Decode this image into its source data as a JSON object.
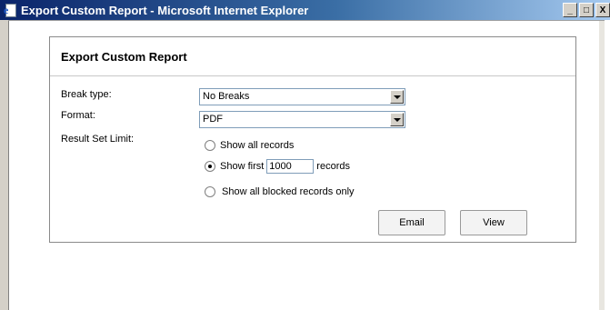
{
  "window": {
    "title": "Export Custom Report - Microsoft Internet Explorer",
    "icon": "ie-icon",
    "controls": [
      "_",
      "□",
      "X"
    ]
  },
  "panel": {
    "header": "Export Custom Report",
    "break_type": {
      "label": "Break type:",
      "value": "No Breaks"
    },
    "format": {
      "label": "Format:",
      "value": "PDF"
    },
    "result_set_limit": {
      "label": "Result Set Limit:",
      "options": {
        "all": "Show all records",
        "first_prefix": "Show first",
        "first_value": "1000",
        "first_suffix": "records",
        "blocked": "Show all blocked records only"
      },
      "selected": "first"
    },
    "buttons": {
      "email": "Email",
      "view": "View"
    }
  }
}
